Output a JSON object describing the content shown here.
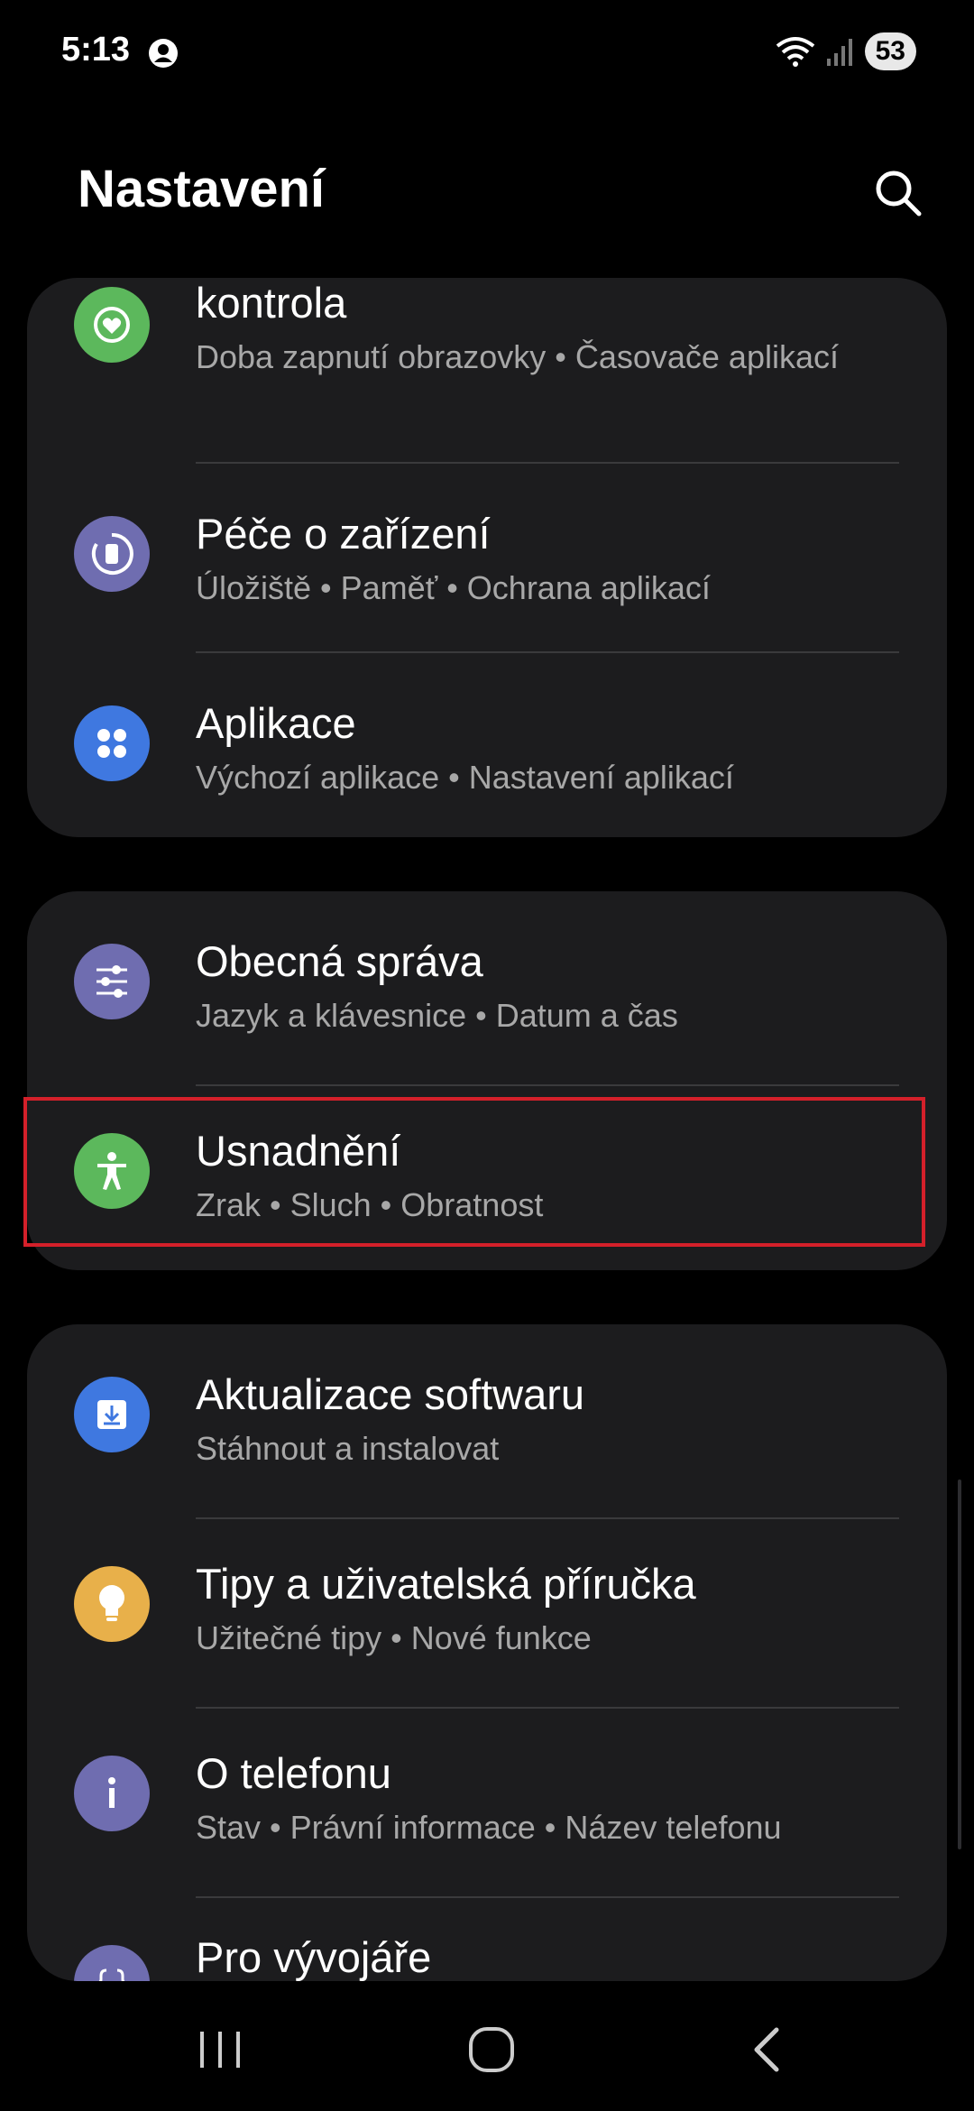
{
  "status_bar": {
    "time": "5:13",
    "battery": "53"
  },
  "header": {
    "title": "Nastavení"
  },
  "cards": [
    {
      "items": [
        {
          "title": "kontrola",
          "subtitle": "Doba zapnutí obrazovky  •  Časovače aplikací",
          "icon": "digital-wellbeing-icon",
          "color": "#5cb85c"
        },
        {
          "title": "Péče o zařízení",
          "subtitle": "Úložiště  •  Paměť  •  Ochrana aplikací",
          "icon": "device-care-icon",
          "color": "#6f6db0"
        },
        {
          "title": "Aplikace",
          "subtitle": "Výchozí aplikace  •  Nastavení aplikací",
          "icon": "apps-icon",
          "color": "#3f78e0"
        }
      ]
    },
    {
      "items": [
        {
          "title": "Obecná správa",
          "subtitle": "Jazyk a klávesnice  •  Datum a čas",
          "icon": "sliders-icon",
          "color": "#6f6db0"
        },
        {
          "title": "Usnadnění",
          "subtitle": "Zrak  •  Sluch  •  Obratnost",
          "icon": "accessibility-icon",
          "color": "#5cb85c"
        }
      ]
    },
    {
      "items": [
        {
          "title": "Aktualizace softwaru",
          "subtitle": "Stáhnout a instalovat",
          "icon": "software-update-icon",
          "color": "#3f78e0"
        },
        {
          "title": "Tipy a uživatelská příručka",
          "subtitle": "Užitečné tipy  •  Nové funkce",
          "icon": "lightbulb-icon",
          "color": "#e8b04a"
        },
        {
          "title": "O telefonu",
          "subtitle": "Stav  •  Právní informace  •  Název telefonu",
          "icon": "info-icon",
          "color": "#6f6db0"
        },
        {
          "title": "Pro vývojáře",
          "subtitle": "",
          "icon": "developer-options-icon",
          "color": "#6f6db0"
        }
      ]
    }
  ],
  "nav": {
    "recents": "recents-icon",
    "home": "home-icon",
    "back": "back-icon"
  }
}
